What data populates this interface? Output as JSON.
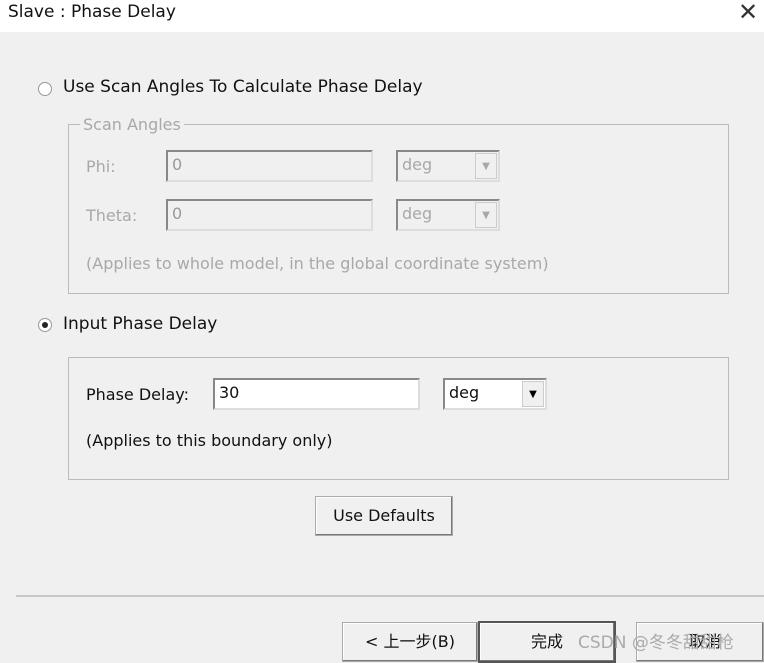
{
  "window": {
    "title": "Slave : Phase Delay",
    "close_icon": "close-icon"
  },
  "option_scan": {
    "label": "Use Scan Angles To Calculate Phase Delay",
    "selected": false
  },
  "scan_angles": {
    "legend": "Scan Angles",
    "phi_label": "Phi:",
    "phi_value": "0",
    "phi_unit": "deg",
    "theta_label": "Theta:",
    "theta_value": "0",
    "theta_unit": "deg",
    "note": "(Applies to whole model, in the global coordinate system)"
  },
  "option_input": {
    "label": "Input Phase Delay",
    "selected": true
  },
  "phase_delay": {
    "label": "Phase Delay:",
    "value": "30",
    "unit": "deg",
    "note": "(Applies to this boundary only)"
  },
  "buttons": {
    "use_defaults": "Use Defaults",
    "back": "< 上一步(B)",
    "finish": "完成",
    "cancel": "取消"
  },
  "watermark": "CSDN @冬冬甜甜枪"
}
